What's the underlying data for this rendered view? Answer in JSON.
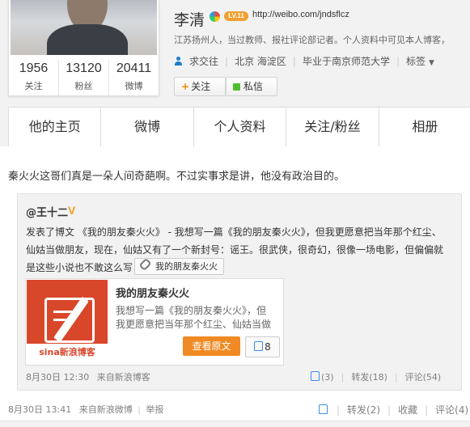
{
  "profile": {
    "name": "李清",
    "level_badge": "LV.11",
    "url": "http://weibo.com/jndsflcz",
    "bio": "江苏扬州人，当过教师、报社评论部记者。个人资料中可见本人博客，",
    "meta": {
      "follow_status": "求交往",
      "location": "北京 海淀区",
      "education": "毕业于南京师范大学",
      "tags_label": "标签"
    },
    "counts": [
      {
        "num": "1956",
        "label": "关注"
      },
      {
        "num": "13120",
        "label": "粉丝"
      },
      {
        "num": "20411",
        "label": "微博"
      }
    ],
    "follow_button": "关注",
    "message_button": "私信"
  },
  "nav": {
    "tabs": [
      "他的主页",
      "微博",
      "个人资料",
      "关注/粉丝",
      "相册"
    ]
  },
  "post": {
    "text": "秦火火这哥们真是一朵人间奇葩啊。不过实事求是讲，他没有政治目的。",
    "repost": {
      "author": "@王十二",
      "lines": [
        "发表了博文 《我的朋友秦火火》 - 我想写一篇《我的朋友秦火火》，但我更愿意把当年那个红尘、",
        "仙姑当做朋友，现在，仙姑又有了一个新封号：谣王。很武侠，很奇幻，很像一场电影，但偏偏就",
        "是这些小说也不敢这么写"
      ],
      "link_chip": "我的朋友秦火火",
      "blog_card": {
        "brand": "sina新浪博客",
        "title": "我的朋友秦火火",
        "excerpt": [
          "我想写一篇《我的朋友秦火火》，但",
          "我更愿意把当年那个红尘、仙姑当做"
        ],
        "read_button": "查看原文",
        "likes": "8"
      },
      "time": "8月30日 12:30",
      "source": "来自新浪博客",
      "likes": "(3)",
      "forwards": "转发(18)",
      "comments": "评论(54)"
    },
    "time": "8月30日 13:41",
    "source": "来自新浪微博",
    "report": "举报",
    "forwards": "转发(2)",
    "collect": "收藏",
    "comments": "评论(4)"
  }
}
